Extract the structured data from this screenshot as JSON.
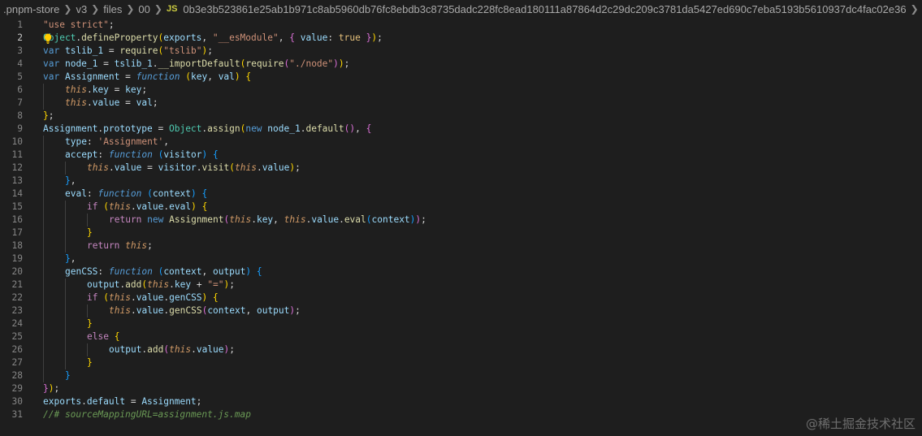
{
  "breadcrumb": {
    "items": [
      ".pnpm-store",
      "v3",
      "files",
      "00"
    ],
    "file_type": "JS",
    "file_name": "0b3e3b523861e25ab1b971c8ab5960db76fc8ebdb3c8735dadc228fc8ead180111a87864d2c29dc209c3781da5427ed690c7eba5193b5610937dc4fac02e36",
    "trailing": "..."
  },
  "colors": {
    "background": "#1e1e1e",
    "keyword": "#569cd6",
    "control": "#c586c0",
    "string": "#ce9178",
    "variable": "#9cdcfe",
    "function": "#dcdcaa",
    "class": "#4ec9b0",
    "comment": "#6a9955",
    "this": "#d19a66",
    "bracket_gold": "#ffd700",
    "bracket_pink": "#da70d6",
    "bracket_blue": "#179fff",
    "constant": "#e5c07b"
  },
  "editor": {
    "lines": [
      {
        "n": "1",
        "text": "\"use strict\";"
      },
      {
        "n": "2",
        "text": "Object.defineProperty(exports, \"__esModule\", { value: true });"
      },
      {
        "n": "3",
        "text": "var tslib_1 = require(\"tslib\");"
      },
      {
        "n": "4",
        "text": "var node_1 = tslib_1.__importDefault(require(\"./node\"));"
      },
      {
        "n": "5",
        "text": "var Assignment = function (key, val) {"
      },
      {
        "n": "6",
        "text": "    this.key = key;"
      },
      {
        "n": "7",
        "text": "    this.value = val;"
      },
      {
        "n": "8",
        "text": "};"
      },
      {
        "n": "9",
        "text": "Assignment.prototype = Object.assign(new node_1.default(), {"
      },
      {
        "n": "10",
        "text": "    type: 'Assignment',"
      },
      {
        "n": "11",
        "text": "    accept: function (visitor) {"
      },
      {
        "n": "12",
        "text": "        this.value = visitor.visit(this.value);"
      },
      {
        "n": "13",
        "text": "    },"
      },
      {
        "n": "14",
        "text": "    eval: function (context) {"
      },
      {
        "n": "15",
        "text": "        if (this.value.eval) {"
      },
      {
        "n": "16",
        "text": "            return new Assignment(this.key, this.value.eval(context));"
      },
      {
        "n": "17",
        "text": "        }"
      },
      {
        "n": "18",
        "text": "        return this;"
      },
      {
        "n": "19",
        "text": "    },"
      },
      {
        "n": "20",
        "text": "    genCSS: function (context, output) {"
      },
      {
        "n": "21",
        "text": "        output.add(this.key + \"=\");"
      },
      {
        "n": "22",
        "text": "        if (this.value.genCSS) {"
      },
      {
        "n": "23",
        "text": "            this.value.genCSS(context, output);"
      },
      {
        "n": "24",
        "text": "        }"
      },
      {
        "n": "25",
        "text": "        else {"
      },
      {
        "n": "26",
        "text": "            output.add(this.value);"
      },
      {
        "n": "27",
        "text": "        }"
      },
      {
        "n": "28",
        "text": "    }"
      },
      {
        "n": "29",
        "text": "});"
      },
      {
        "n": "30",
        "text": "exports.default = Assignment;"
      },
      {
        "n": "31",
        "text": "//# sourceMappingURL=assignment.js.map"
      }
    ]
  },
  "watermark": "@稀土掘金技术社区"
}
